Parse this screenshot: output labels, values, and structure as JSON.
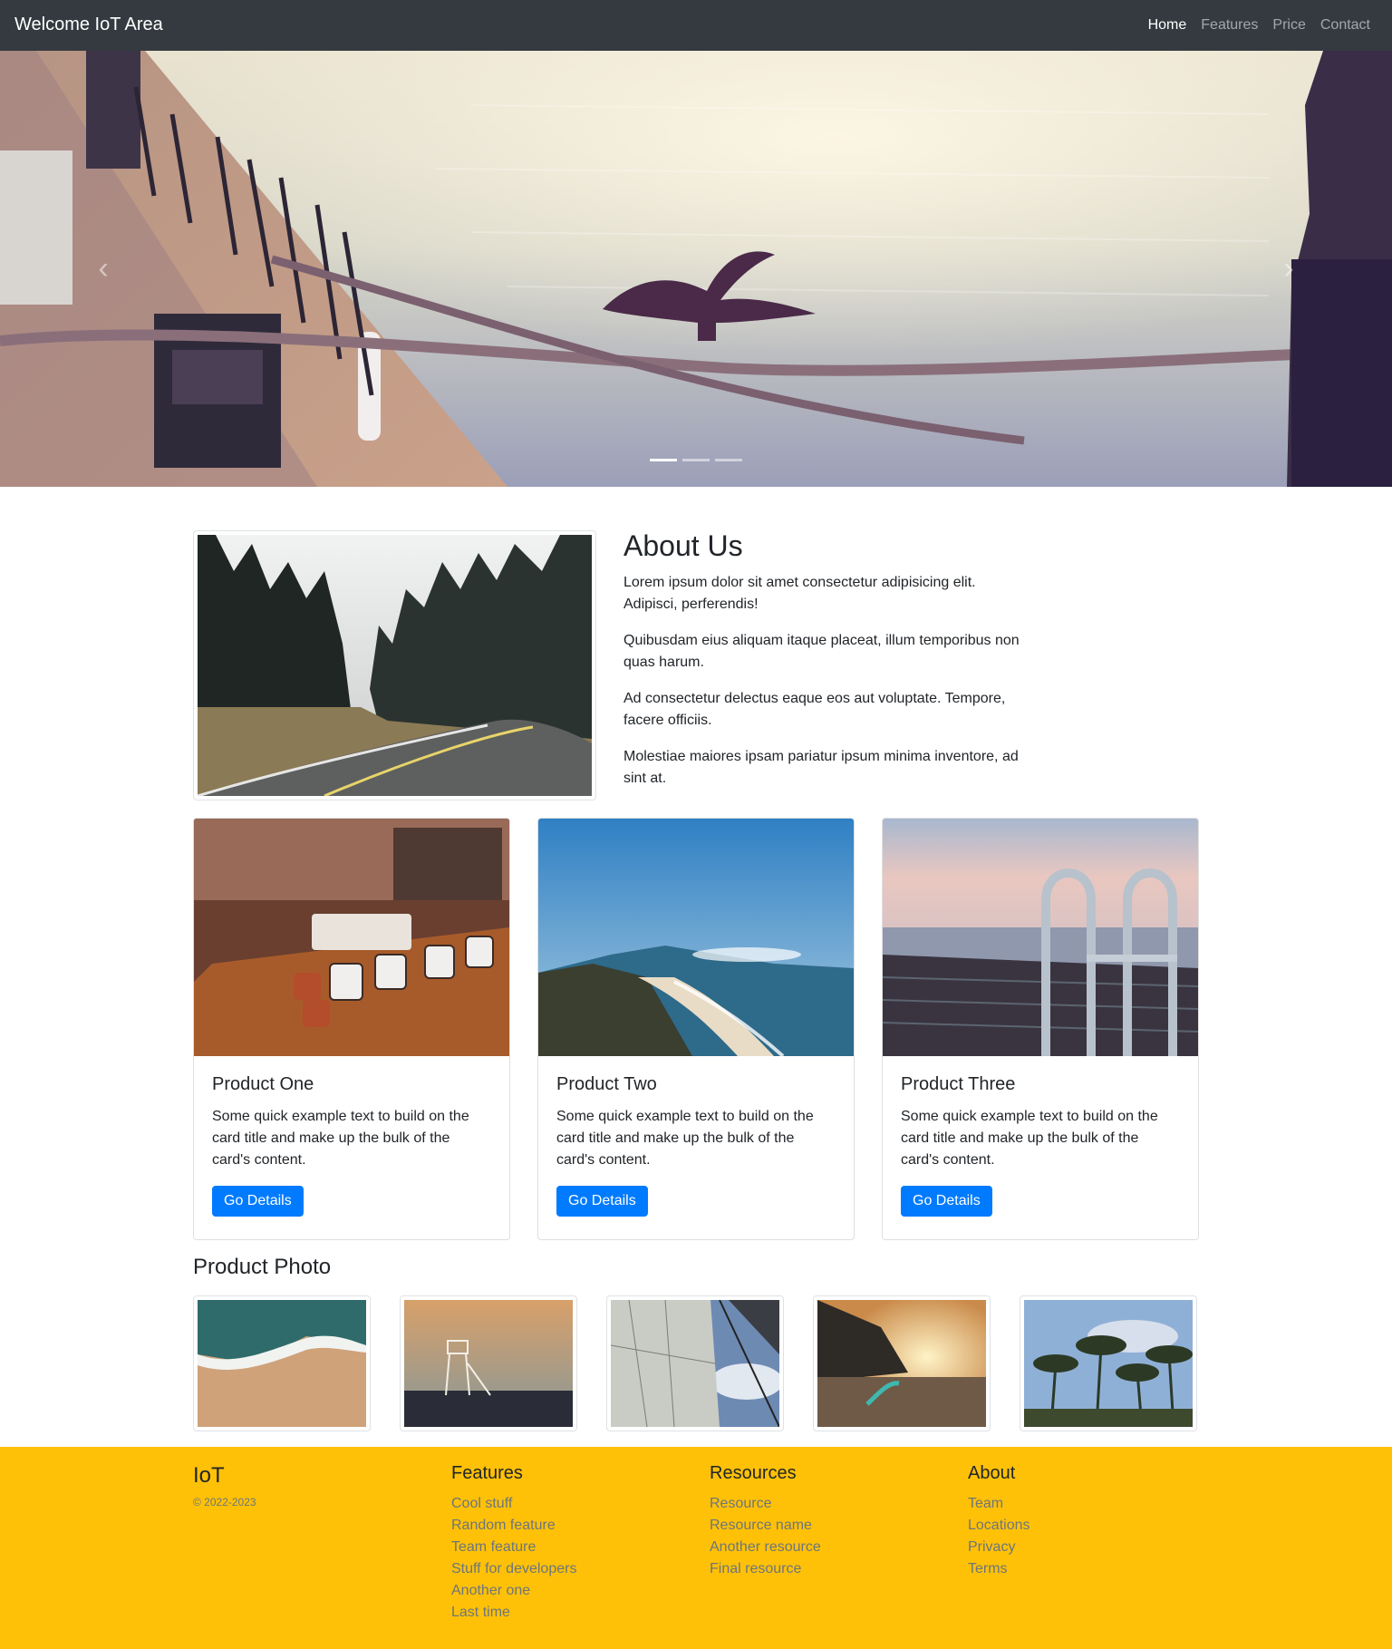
{
  "navbar": {
    "brand": "Welcome IoT Area",
    "links": [
      "Home",
      "Features",
      "Price",
      "Contact"
    ],
    "active": "Home"
  },
  "hero": {
    "carousel_position": {
      "current": 1,
      "total": 3
    },
    "prev_icon": "chevron-left-icon",
    "next_icon": "chevron-right-icon"
  },
  "about": {
    "title": "About Us",
    "paragraphs": [
      "Lorem ipsum dolor sit amet consectetur adipisicing elit. Adipisci, perferendis!",
      "Quibusdam eius aliquam itaque placeat, illum temporibus non quas harum.",
      "Ad consectetur delectus eaque eos aut voluptate. Tempore, facere officiis.",
      "Molestiae maiores ipsam pariatur ipsum minima inventore, ad sint at."
    ]
  },
  "cards": [
    {
      "title": "Product One",
      "text": "Some quick example text to build on the card title and make up the bulk of the card's content.",
      "button": "Go Details"
    },
    {
      "title": "Product Two",
      "text": "Some quick example text to build on the card title and make up the bulk of the card's content.",
      "button": "Go Details"
    },
    {
      "title": "Product Three",
      "text": "Some quick example text to build on the card title and make up the bulk of the card's content.",
      "button": "Go Details"
    }
  ],
  "product_photo": {
    "title": "Product Photo"
  },
  "footer": {
    "brand": "IoT",
    "copyright": "© 2022-2023",
    "columns": [
      {
        "title": "Features",
        "items": [
          "Cool stuff",
          "Random feature",
          "Team feature",
          "Stuff for developers",
          "Another one",
          "Last time"
        ]
      },
      {
        "title": "Resources",
        "items": [
          "Resource",
          "Resource name",
          "Another resource",
          "Final resource"
        ]
      },
      {
        "title": "About",
        "items": [
          "Team",
          "Locations",
          "Privacy",
          "Terms"
        ]
      }
    ]
  },
  "colors": {
    "navbar_bg": "#343a40",
    "primary": "#007bff",
    "footer_bg": "#ffc107",
    "muted": "#6c757d"
  }
}
